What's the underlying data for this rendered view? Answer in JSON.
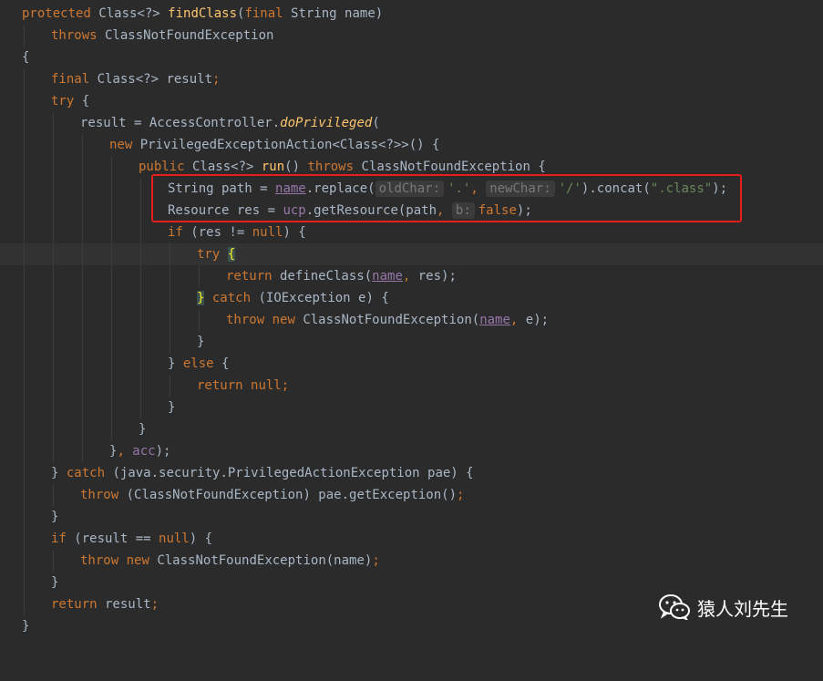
{
  "editor": {
    "lines": {
      "l1": {
        "a": "protected",
        "b": " Class<?> ",
        "c": "findClass",
        "d": "(",
        "e": "final",
        "f": " String name)"
      },
      "l2": {
        "a": "throws",
        "b": " ClassNotFoundException"
      },
      "l3": {
        "a": "{"
      },
      "l4": {
        "a": "final",
        "b": " Class<?> result",
        "c": ";"
      },
      "l5": {
        "a": "try",
        "b": " {"
      },
      "l6": {
        "a": "result = AccessController.",
        "b": "doPrivileged",
        "c": "("
      },
      "l7": {
        "a": "new",
        "b": " PrivilegedExceptionAction<Class<?>>() {"
      },
      "l8": {
        "a": "public",
        "b": " Class<?> ",
        "c": "run",
        "d": "() ",
        "e": "throws",
        "f": " ClassNotFoundException {"
      },
      "l9": {
        "a": "String path = ",
        "b": "name",
        "c": ".replace(",
        "hint1": "oldChar:",
        "d": "'.'",
        "e": ", ",
        "hint2": "newChar:",
        "f": "'/'",
        "g": ").concat(",
        "h": "\".class\"",
        "i": ");"
      },
      "l10": {
        "a": "Resource res = ",
        "b": "ucp",
        "c": ".getResource(path",
        "d": ", ",
        "hint1": "b:",
        "e": "false",
        "f": ");"
      },
      "l11": {
        "a": "if",
        "b": " (res != ",
        "c": "null",
        "d": ") {"
      },
      "l12": {
        "a": "try",
        "b": " ",
        "c": "{"
      },
      "l13": {
        "a": "return",
        "b": " defineClass(",
        "c": "name",
        "d": ", ",
        "e": "res);"
      },
      "l14": {
        "a": "}",
        "b": " ",
        "c": "catch",
        "d": " (IOException e) {"
      },
      "l15": {
        "a": "throw",
        "b": " ",
        "c": "new",
        "d": " ClassNotFoundException(",
        "e": "name",
        "f": ", ",
        "g": "e);"
      },
      "l16": {
        "a": "}"
      },
      "l17": {
        "a": "} ",
        "b": "else",
        "c": " {"
      },
      "l18": {
        "a": "return",
        "b": " ",
        "c": "null",
        "d": ";"
      },
      "l19": {
        "a": "}"
      },
      "l20": {
        "a": "}"
      },
      "l21": {
        "a": "}",
        "b": ", ",
        "c": "acc",
        "d": ");"
      },
      "l22": {
        "a": "} ",
        "b": "catch",
        "c": " (java.security.PrivilegedActionException pae) {"
      },
      "l23": {
        "a": "throw",
        "b": " (ClassNotFoundException) pae.getException()",
        "c": ";"
      },
      "l24": {
        "a": "}"
      },
      "l25": {
        "a": "if",
        "b": " (result == ",
        "c": "null",
        "d": ") {"
      },
      "l26": {
        "a": "throw",
        "b": " ",
        "c": "new",
        "d": " ClassNotFoundException(name)",
        "e": ";"
      },
      "l27": {
        "a": "}"
      },
      "l28": {
        "a": "return",
        "b": " result",
        "c": ";"
      },
      "l29": {
        "a": "}"
      }
    }
  },
  "watermark": {
    "text": "猿人刘先生",
    "icon": "wechat-icon"
  },
  "colors": {
    "highlight_box": "#e81d1d",
    "background": "#2b2b2b",
    "keyword": "#cc7832",
    "string": "#6a8759",
    "method": "#ffc66d",
    "field": "#9876aa"
  }
}
